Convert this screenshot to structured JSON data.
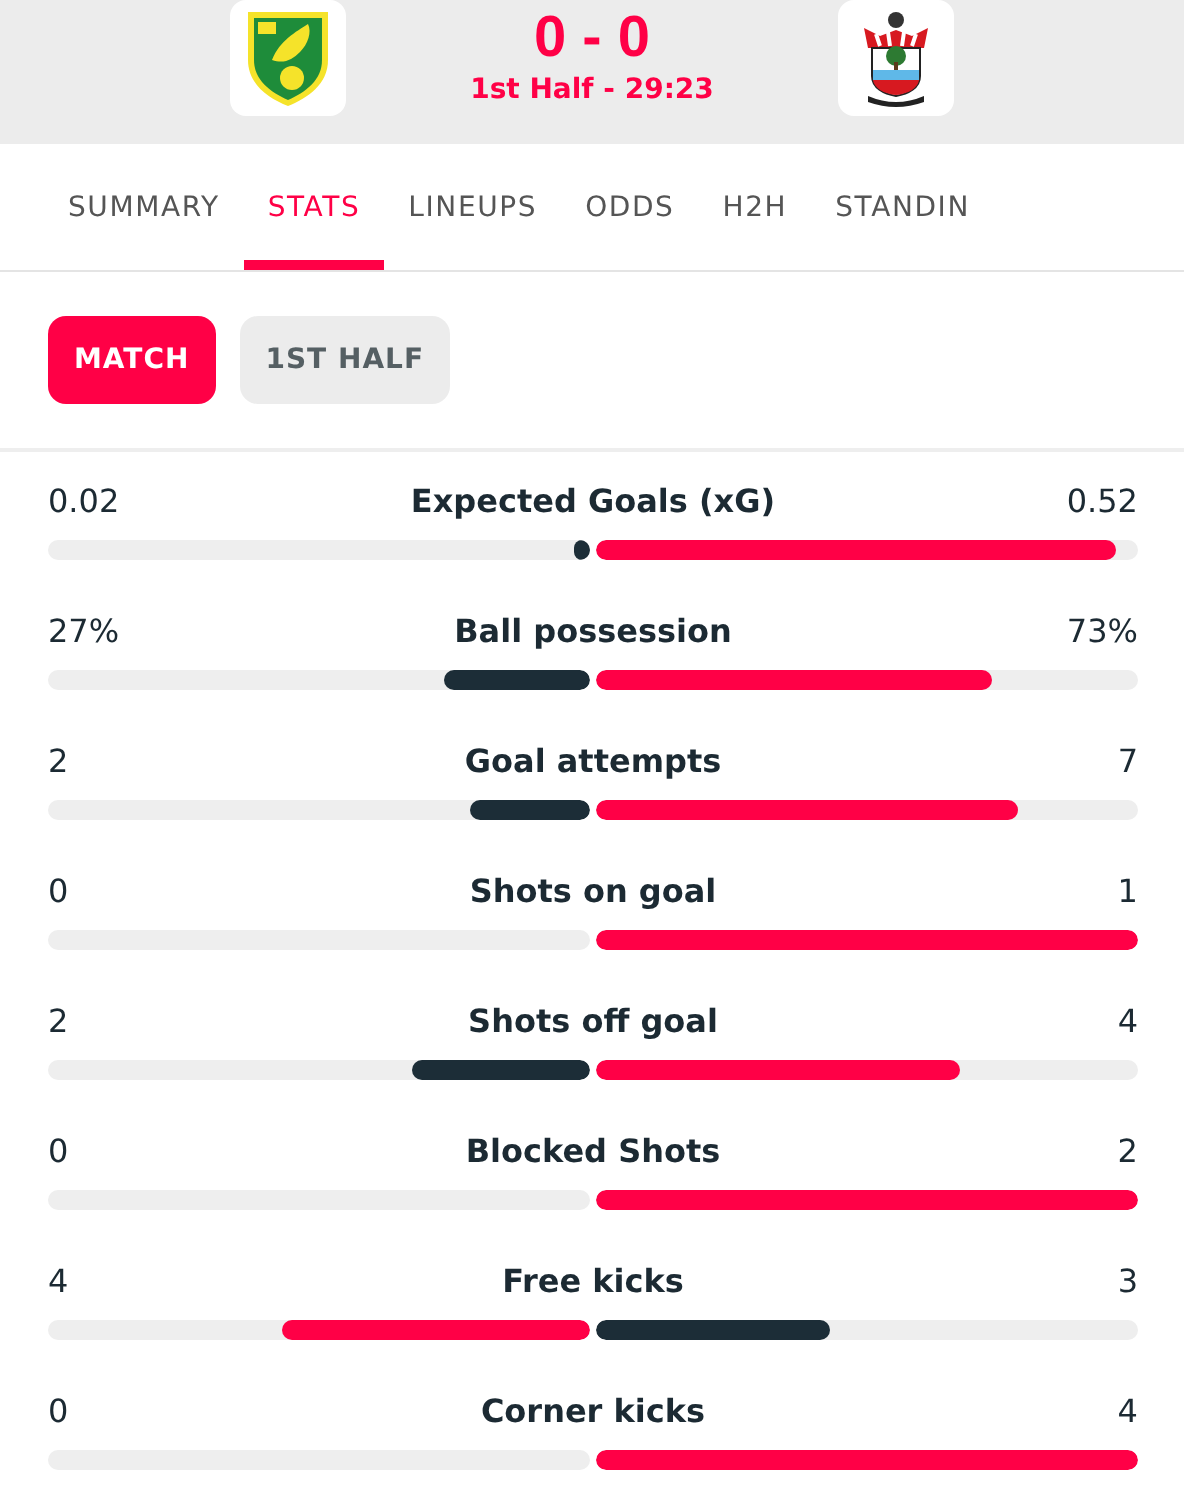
{
  "match": {
    "teams": [
      {
        "kind": "canary-crest"
      },
      {
        "kind": "striped-crest"
      }
    ],
    "score": "0 - 0",
    "status": "1st Half - 29:23"
  },
  "tabs": [
    {
      "label": "SUMMARY",
      "selected": false
    },
    {
      "label": "STATS",
      "selected": true
    },
    {
      "label": "LINEUPS",
      "selected": false
    },
    {
      "label": "ODDS",
      "selected": false
    },
    {
      "label": "H2H",
      "selected": false
    },
    {
      "label": "STANDIN",
      "selected": false
    }
  ],
  "periods": [
    {
      "label": "MATCH",
      "selected": true
    },
    {
      "label": "1ST HALF",
      "selected": false
    }
  ],
  "stats": [
    {
      "name": "Expected Goals (xG)",
      "home": {
        "value": "0.02",
        "level": 0.03
      },
      "away": {
        "value": "0.52",
        "level": 0.96
      }
    },
    {
      "name": "Ball possession",
      "home": {
        "value": "27%",
        "level": 0.27
      },
      "away": {
        "value": "73%",
        "level": 0.73
      }
    },
    {
      "name": "Goal attempts",
      "home": {
        "value": "2",
        "level": 0.22
      },
      "away": {
        "value": "7",
        "level": 0.78
      }
    },
    {
      "name": "Shots on goal",
      "home": {
        "value": "0"
      },
      "away": {
        "value": "1",
        "level": 1
      }
    },
    {
      "name": "Shots off goal",
      "home": {
        "value": "2",
        "level": 0.33
      },
      "away": {
        "value": "4",
        "level": 0.67
      }
    },
    {
      "name": "Blocked Shots",
      "home": {
        "value": "0"
      },
      "away": {
        "value": "2",
        "level": 1
      }
    },
    {
      "name": "Free kicks",
      "home": {
        "value": "4",
        "level": 0.57
      },
      "away": {
        "value": "3",
        "level": 0.43
      }
    },
    {
      "name": "Corner kicks",
      "home": {
        "value": "0"
      },
      "away": {
        "value": "4",
        "level": 1
      }
    }
  ]
}
